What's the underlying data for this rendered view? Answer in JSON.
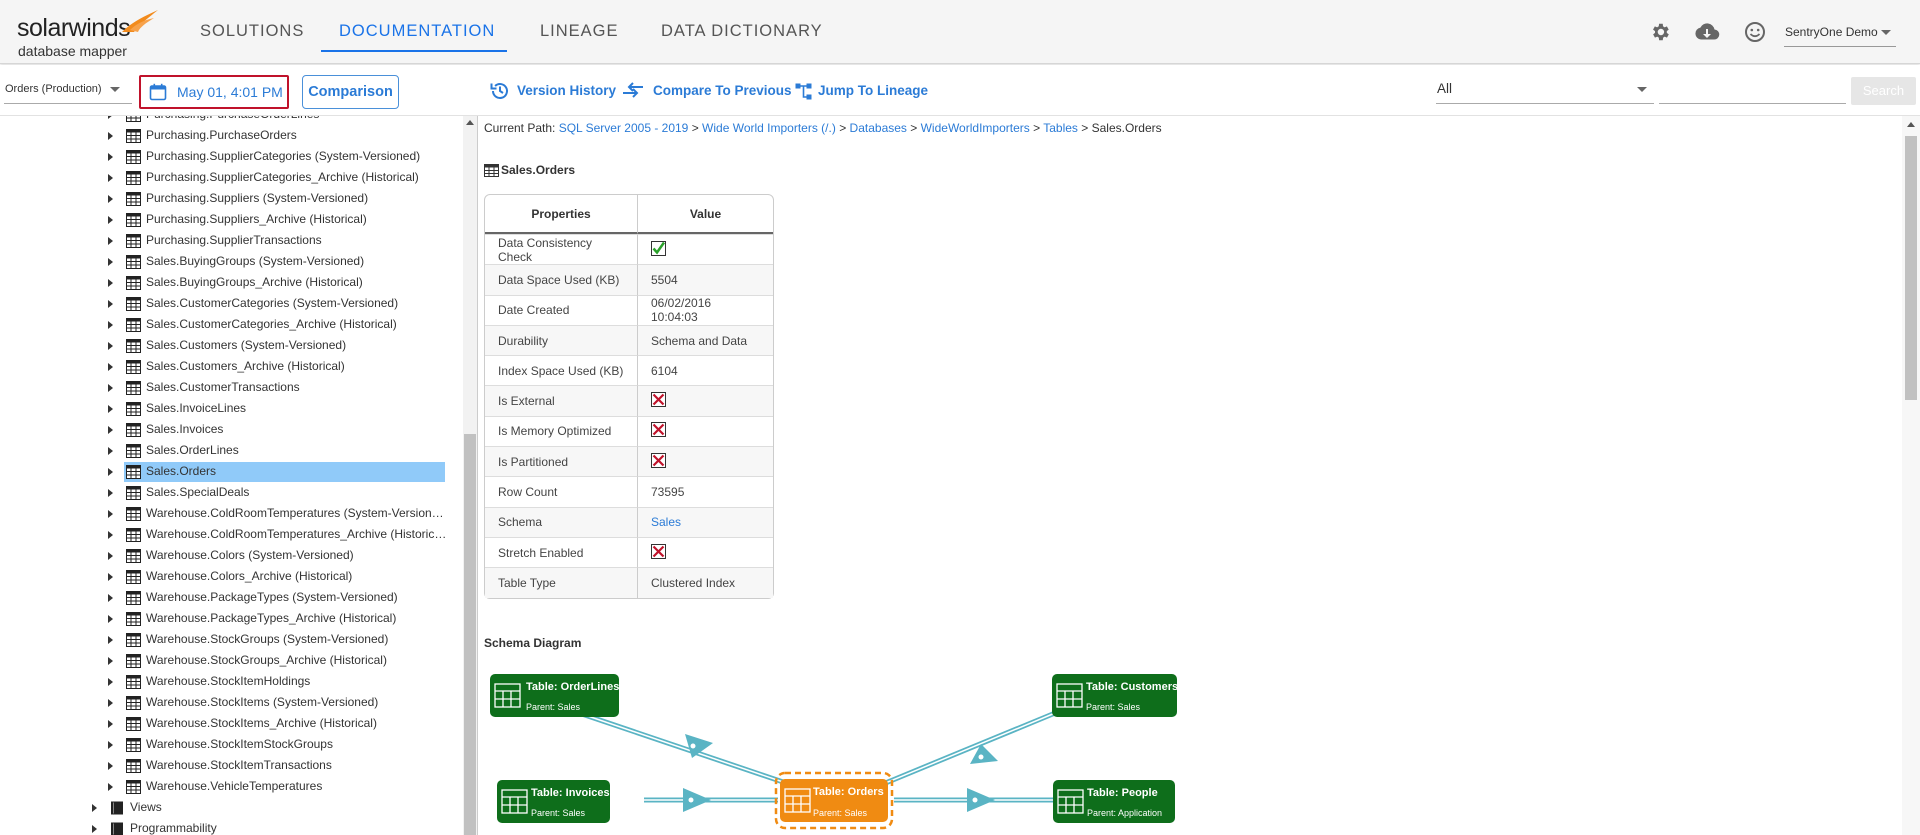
{
  "brand": {
    "name": "solarwinds",
    "product": "database mapper"
  },
  "nav": {
    "items": [
      "SOLUTIONS",
      "DOCUMENTATION",
      "LINEAGE",
      "DATA DICTIONARY"
    ],
    "active": "DOCUMENTATION"
  },
  "user": {
    "name": "SentryOne Demo"
  },
  "toolbar": {
    "database": "Orders (Production)",
    "date": "May 01, 4:01 PM",
    "comparison": "Comparison",
    "version_history": "Version History",
    "compare_previous": "Compare To Previous",
    "jump_lineage": "Jump To Lineage",
    "filter": "All",
    "search_value": "",
    "search_button": "Search"
  },
  "tree": {
    "items": [
      {
        "label": "Purchasing.PurchaseOrderLines",
        "indent": 1
      },
      {
        "label": "Purchasing.PurchaseOrders",
        "indent": 1
      },
      {
        "label": "Purchasing.SupplierCategories (System-Versioned)",
        "indent": 1
      },
      {
        "label": "Purchasing.SupplierCategories_Archive (Historical)",
        "indent": 1
      },
      {
        "label": "Purchasing.Suppliers (System-Versioned)",
        "indent": 1
      },
      {
        "label": "Purchasing.Suppliers_Archive (Historical)",
        "indent": 1
      },
      {
        "label": "Purchasing.SupplierTransactions",
        "indent": 1
      },
      {
        "label": "Sales.BuyingGroups (System-Versioned)",
        "indent": 1
      },
      {
        "label": "Sales.BuyingGroups_Archive (Historical)",
        "indent": 1
      },
      {
        "label": "Sales.CustomerCategories (System-Versioned)",
        "indent": 1
      },
      {
        "label": "Sales.CustomerCategories_Archive (Historical)",
        "indent": 1
      },
      {
        "label": "Sales.Customers (System-Versioned)",
        "indent": 1
      },
      {
        "label": "Sales.Customers_Archive (Historical)",
        "indent": 1
      },
      {
        "label": "Sales.CustomerTransactions",
        "indent": 1
      },
      {
        "label": "Sales.InvoiceLines",
        "indent": 1
      },
      {
        "label": "Sales.Invoices",
        "indent": 1
      },
      {
        "label": "Sales.OrderLines",
        "indent": 1
      },
      {
        "label": "Sales.Orders",
        "indent": 1,
        "selected": true
      },
      {
        "label": "Sales.SpecialDeals",
        "indent": 1
      },
      {
        "label": "Warehouse.ColdRoomTemperatures (System-Version…",
        "indent": 1
      },
      {
        "label": "Warehouse.ColdRoomTemperatures_Archive (Historic…",
        "indent": 1
      },
      {
        "label": "Warehouse.Colors (System-Versioned)",
        "indent": 1
      },
      {
        "label": "Warehouse.Colors_Archive (Historical)",
        "indent": 1
      },
      {
        "label": "Warehouse.PackageTypes (System-Versioned)",
        "indent": 1
      },
      {
        "label": "Warehouse.PackageTypes_Archive (Historical)",
        "indent": 1
      },
      {
        "label": "Warehouse.StockGroups (System-Versioned)",
        "indent": 1
      },
      {
        "label": "Warehouse.StockGroups_Archive (Historical)",
        "indent": 1
      },
      {
        "label": "Warehouse.StockItemHoldings",
        "indent": 1
      },
      {
        "label": "Warehouse.StockItems (System-Versioned)",
        "indent": 1
      },
      {
        "label": "Warehouse.StockItems_Archive (Historical)",
        "indent": 1
      },
      {
        "label": "Warehouse.StockItemStockGroups",
        "indent": 1
      },
      {
        "label": "Warehouse.StockItemTransactions",
        "indent": 1
      },
      {
        "label": "Warehouse.VehicleTemperatures",
        "indent": 1
      },
      {
        "label": "Views",
        "indent": 0,
        "folder": true
      },
      {
        "label": "Programmability",
        "indent": 0,
        "folder": true
      }
    ]
  },
  "breadcrumb": {
    "prefix": "Current Path:",
    "links": [
      "SQL Server 2005 - 2019",
      "Wide World Importers (/.)",
      "Databases",
      "WideWorldImporters",
      "Tables"
    ],
    "current": "Sales.Orders"
  },
  "object": {
    "title": "Sales.Orders"
  },
  "properties": {
    "headers": [
      "Properties",
      "Value"
    ],
    "rows": [
      {
        "name": "Data Consistency Check",
        "value": "",
        "icon": "check"
      },
      {
        "name": "Data Space Used (KB)",
        "value": "5504"
      },
      {
        "name": "Date Created",
        "value": "06/02/2016 10:04:03"
      },
      {
        "name": "Durability",
        "value": "Schema and Data"
      },
      {
        "name": "Index Space Used (KB)",
        "value": "6104"
      },
      {
        "name": "Is External",
        "value": "",
        "icon": "cross"
      },
      {
        "name": "Is Memory Optimized",
        "value": "",
        "icon": "cross"
      },
      {
        "name": "Is Partitioned",
        "value": "",
        "icon": "cross"
      },
      {
        "name": "Row Count",
        "value": "73595"
      },
      {
        "name": "Schema",
        "value": "Sales",
        "link": true
      },
      {
        "name": "Stretch Enabled",
        "value": "",
        "icon": "cross"
      },
      {
        "name": "Table Type",
        "value": "Clustered Index"
      }
    ]
  },
  "schema": {
    "title": "Schema Diagram",
    "nodes": [
      {
        "id": "orderlines",
        "title": "Table: OrderLines",
        "parent": "Parent: Sales",
        "color": "#0e6e1b"
      },
      {
        "id": "customers",
        "title": "Table: Customers",
        "parent": "Parent: Sales",
        "color": "#0e6e1b"
      },
      {
        "id": "invoices",
        "title": "Table: Invoices",
        "parent": "Parent: Sales",
        "color": "#0e6e1b"
      },
      {
        "id": "orders",
        "title": "Table: Orders",
        "parent": "Parent: Sales",
        "color": "#f08b12",
        "focus": true
      },
      {
        "id": "people",
        "title": "Table: People",
        "parent": "Parent: Application",
        "color": "#0e6e1b"
      }
    ],
    "edge_color": "#5ab4c4"
  },
  "colors": {
    "accent": "#2b7bd6",
    "highlight": "#c0122b",
    "selected_row": "#90caf9"
  }
}
